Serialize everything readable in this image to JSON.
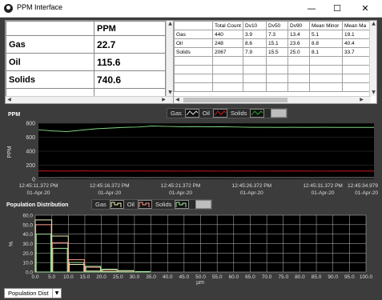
{
  "window": {
    "title": "PPM Interface",
    "minimize_glyph": "—",
    "maximize_glyph": "☐",
    "close_glyph": "✕"
  },
  "ppm_table": {
    "header": "PPM",
    "rows": [
      {
        "label": "Gas",
        "value": "22.7"
      },
      {
        "label": "Oil",
        "value": "115.6"
      },
      {
        "label": "Solids",
        "value": "740.6"
      }
    ]
  },
  "stats_table": {
    "columns": [
      "",
      "Total Count",
      "Dv10",
      "Dv50",
      "Dv90",
      "Mean Minor",
      "Mean Ma"
    ],
    "rows": [
      [
        "Gas",
        "440",
        "3.9",
        "7.3",
        "13.4",
        "5.1",
        "19.1"
      ],
      [
        "Oil",
        "248",
        "8.6",
        "15.1",
        "23.6",
        "8.8",
        "40.4"
      ],
      [
        "Solids",
        "2067",
        "7.9",
        "15.5",
        "25.0",
        "8.1",
        "33.7"
      ]
    ]
  },
  "legend": {
    "gas": "Gas",
    "oil": "Oil",
    "solids": "Solids"
  },
  "colors": {
    "gas": "#2fa32f",
    "oil": "#7fd37f",
    "solids": "#d01818",
    "gas_bar": "#f2f2b8",
    "oil_bar": "#ff9a8a",
    "solids_bar": "#9fe89f"
  },
  "ppm_chart_title": "PPM",
  "dist_chart_title": "Population Distribution",
  "dropdown": {
    "value": "Population Dist"
  },
  "chart_data": [
    {
      "type": "line",
      "title": "PPM",
      "ylabel": "PPM",
      "ylim": [
        0,
        800
      ],
      "yticks": [
        "800",
        "600",
        "400",
        "200",
        "0"
      ],
      "xticks": [
        {
          "time": "12:45:11.372 PM",
          "date": "01-Apr-20"
        },
        {
          "time": "12:45:16.372 PM",
          "date": "01-Apr-20"
        },
        {
          "time": "12:45:21.372 PM",
          "date": "01-Apr-20"
        },
        {
          "time": "12:45:26.372 PM",
          "date": "01-Apr-20"
        },
        {
          "time": "12:45:31.372 PM",
          "date": "01-Apr-20"
        },
        {
          "time": "12:45:34.979",
          "date": "01-Apr-20"
        }
      ],
      "x_seconds": [
        0,
        1,
        2,
        3,
        4,
        5,
        6,
        7,
        8,
        9,
        10,
        11,
        12,
        13,
        14,
        15,
        16,
        17,
        18,
        19,
        20,
        21,
        22,
        23.6
      ],
      "series": [
        {
          "name": "Solids",
          "values": [
            705,
            690,
            680,
            700,
            720,
            730,
            740,
            745,
            760,
            755,
            750,
            752,
            748,
            750,
            745,
            742,
            741,
            740,
            741,
            740,
            741,
            740,
            740,
            740
          ]
        },
        {
          "name": "Oil",
          "values": [
            118,
            117,
            116,
            118,
            117,
            116,
            116,
            117,
            116,
            116,
            115,
            116,
            116,
            115,
            116,
            116,
            115,
            116,
            116,
            116,
            115,
            116,
            116,
            116
          ]
        },
        {
          "name": "Gas",
          "values": [
            22,
            22,
            23,
            23,
            22,
            23,
            23,
            22,
            23,
            23,
            22,
            23,
            23,
            23,
            22,
            23,
            23,
            23,
            23,
            22,
            23,
            23,
            23,
            23
          ]
        }
      ]
    },
    {
      "type": "bar",
      "title": "Population Distribution",
      "xlabel": "µm",
      "ylabel": "%",
      "ylim": [
        0,
        60
      ],
      "xlim": [
        0,
        100
      ],
      "yticks": [
        "60.0",
        "50.0",
        "40.0",
        "30.0",
        "20.0",
        "10.0",
        "0.0"
      ],
      "xticks": [
        "0.0",
        "5.0",
        "10.0",
        "15.0",
        "20.0",
        "25.0",
        "30.0",
        "35.0",
        "40.0",
        "45.0",
        "50.0",
        "55.0",
        "60.0",
        "65.0",
        "70.0",
        "75.0",
        "80.0",
        "85.0",
        "90.0",
        "95.0",
        "100.0"
      ],
      "bin_edges": [
        0,
        5,
        10,
        15,
        20,
        25,
        30,
        35,
        40
      ],
      "series": [
        {
          "name": "Gas",
          "values": [
            55,
            38,
            8,
            1,
            0.5,
            0,
            0,
            0
          ]
        },
        {
          "name": "Oil",
          "values": [
            50,
            31,
            13,
            5,
            2,
            1,
            0,
            0
          ]
        },
        {
          "name": "Solids",
          "values": [
            40,
            25,
            10,
            6,
            3,
            1.5,
            0.5,
            0
          ]
        }
      ]
    }
  ]
}
